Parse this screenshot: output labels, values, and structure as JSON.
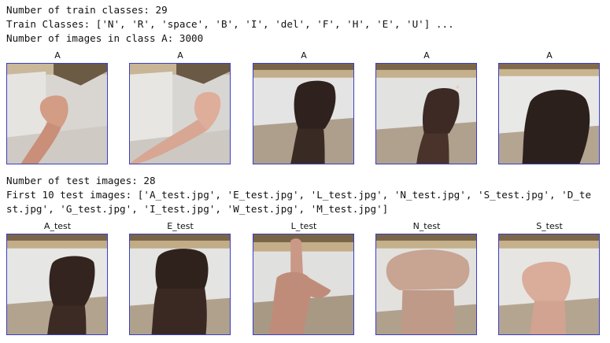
{
  "output": {
    "train_lines": [
      "Number of train classes: 29",
      "Train Classes: ['N', 'R', 'space', 'B', 'I', 'del', 'F', 'H', 'E', 'U'] ...",
      "Number of images in class A: 3000"
    ],
    "test_lines": [
      "Number of test images: 28",
      "First 10 test images: ['A_test.jpg', 'E_test.jpg', 'L_test.jpg', 'N_test.jpg', 'S_test.jpg', 'D_te",
      "st.jpg', 'G_test.jpg', 'I_test.jpg', 'W_test.jpg', 'M_test.jpg']"
    ]
  },
  "train_grid": {
    "titles": [
      "A",
      "A",
      "A",
      "A",
      "A"
    ]
  },
  "test_grid": {
    "titles": [
      "A_test",
      "E_test",
      "L_test",
      "N_test",
      "S_test"
    ]
  },
  "colors": {
    "frame": "#3a3fc4",
    "text": "#111111"
  }
}
